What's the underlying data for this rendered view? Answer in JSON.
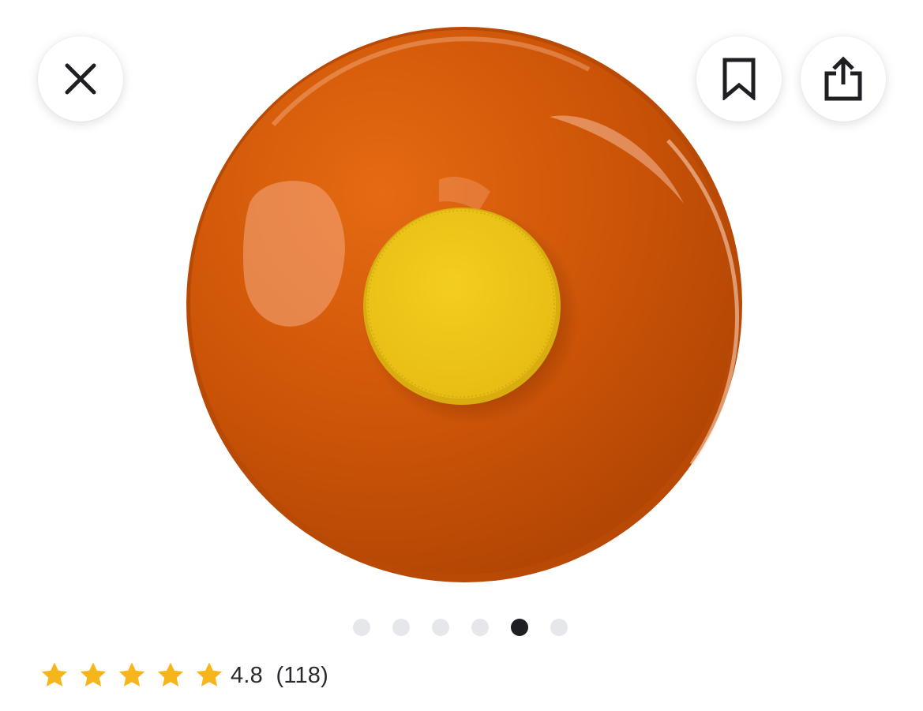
{
  "toolbar": {
    "close_icon": "close-icon",
    "save_icon": "bookmark-icon",
    "share_icon": "share-icon"
  },
  "product": {
    "image_icon": "product-photo",
    "colors": {
      "body": "#cf5408",
      "button": "#f0c417"
    }
  },
  "gallery": {
    "page_count": 6,
    "active_index": 4,
    "active_color": "#1f1f23",
    "inactive_color": "#e6e7ea"
  },
  "rating": {
    "stars": 5,
    "star_color": "#f7b51c",
    "score": "4.8",
    "count": "(118)"
  }
}
